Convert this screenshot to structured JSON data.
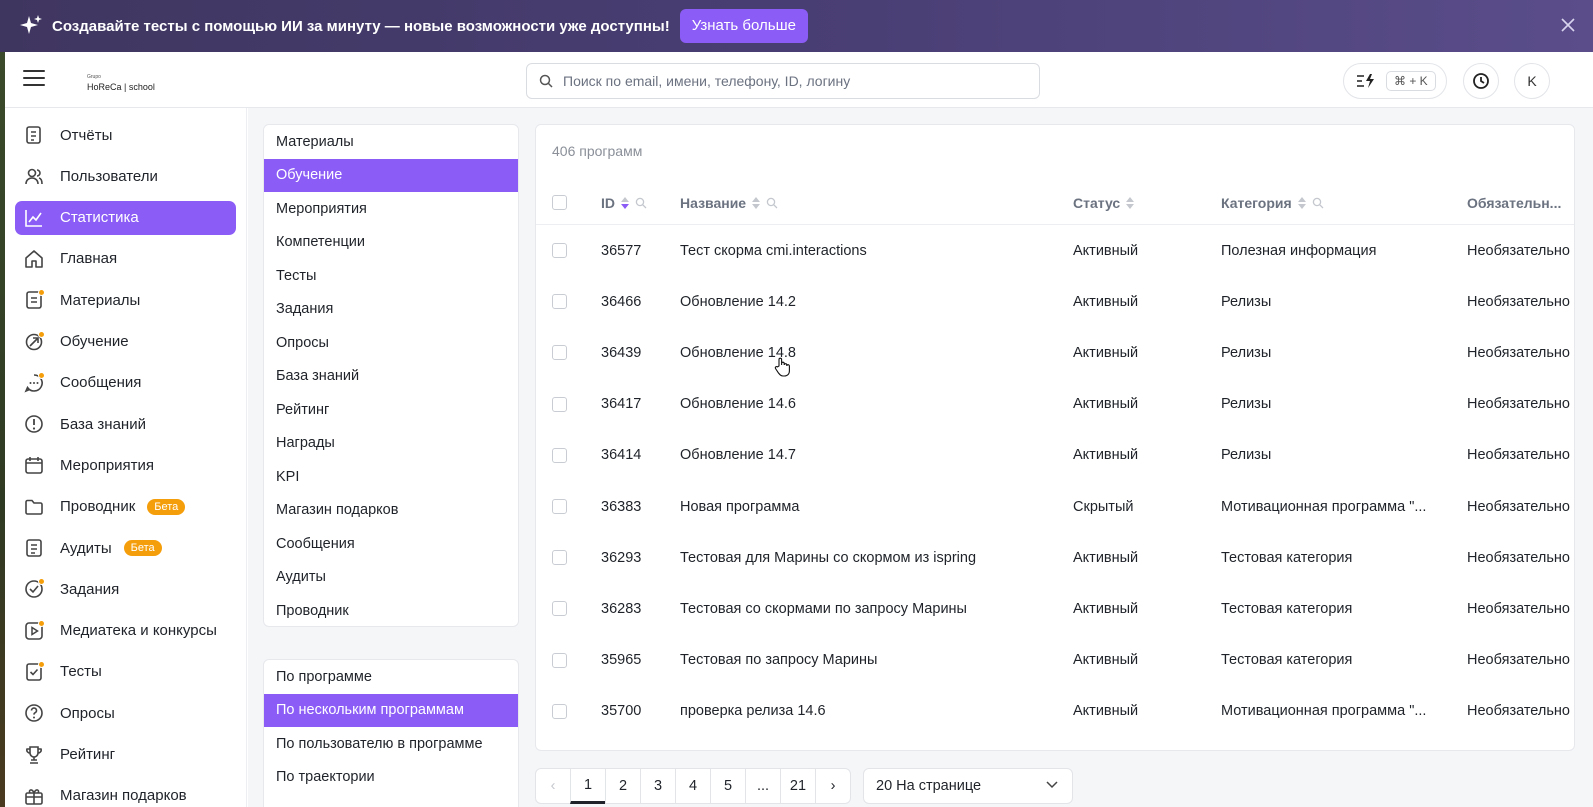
{
  "banner": {
    "text": "Создавайте тесты с помощью ИИ за минуту — новые возможности уже доступны!",
    "button": "Узнать больше"
  },
  "header": {
    "logo_small": "Grupo",
    "logo_text": "HoReCa | school",
    "search_placeholder": "Поиск по email, имени, телефону, ID, логину",
    "shortcut": "⌘ + K",
    "avatar": "K"
  },
  "sidebar": {
    "items": [
      {
        "label": "Отчёты",
        "icon": "report-icon",
        "dot": false
      },
      {
        "label": "Пользователи",
        "icon": "users-icon",
        "dot": false
      },
      {
        "label": "Статистика",
        "icon": "chart-icon",
        "dot": false,
        "active": true
      },
      {
        "label": "Главная",
        "icon": "home-icon",
        "dot": false
      },
      {
        "label": "Материалы",
        "icon": "document-icon",
        "dot": true
      },
      {
        "label": "Обучение",
        "icon": "learning-icon",
        "dot": true
      },
      {
        "label": "Сообщения",
        "icon": "chat-icon",
        "dot": true
      },
      {
        "label": "База знаний",
        "icon": "info-icon",
        "dot": false
      },
      {
        "label": "Мероприятия",
        "icon": "calendar-icon",
        "dot": false
      },
      {
        "label": "Проводник",
        "icon": "folder-icon",
        "dot": false,
        "badge": "Бета"
      },
      {
        "label": "Аудиты",
        "icon": "audit-icon",
        "dot": false,
        "badge": "Бета"
      },
      {
        "label": "Задания",
        "icon": "task-icon",
        "dot": true
      },
      {
        "label": "Медиатека и конкурсы",
        "icon": "media-icon",
        "dot": true
      },
      {
        "label": "Тесты",
        "icon": "test-icon",
        "dot": true
      },
      {
        "label": "Опросы",
        "icon": "question-icon",
        "dot": false
      },
      {
        "label": "Рейтинг",
        "icon": "trophy-icon",
        "dot": false
      },
      {
        "label": "Магазин подарков",
        "icon": "gift-icon",
        "dot": false
      }
    ]
  },
  "categories": [
    "Материалы",
    "Обучение",
    "Мероприятия",
    "Компетенции",
    "Тесты",
    "Задания",
    "Опросы",
    "База знаний",
    "Рейтинг",
    "Награды",
    "KPI",
    "Магазин подарков",
    "Сообщения",
    "Аудиты",
    "Проводник"
  ],
  "categories_active": 1,
  "reports": [
    "По программе",
    "По нескольким программам",
    "По пользователю в программе",
    "По траектории"
  ],
  "reports_active": 1,
  "table": {
    "count": "406 программ",
    "columns": [
      "ID",
      "Название",
      "Статус",
      "Категория",
      "Обязательн..."
    ],
    "rows": [
      [
        "36577",
        "Тест скорма cmi.interactions",
        "Активный",
        "Полезная информация",
        "Необязательно"
      ],
      [
        "36466",
        "Обновление 14.2",
        "Активный",
        "Релизы",
        "Необязательно"
      ],
      [
        "36439",
        "Обновление 14.8",
        "Активный",
        "Релизы",
        "Необязательно"
      ],
      [
        "36417",
        "Обновление 14.6",
        "Активный",
        "Релизы",
        "Необязательно"
      ],
      [
        "36414",
        "Обновление 14.7",
        "Активный",
        "Релизы",
        "Необязательно"
      ],
      [
        "36383",
        "Новая программа",
        "Скрытый",
        "Мотивационная программа \"...",
        "Необязательно"
      ],
      [
        "36293",
        "Тестовая для Марины со скормом из ispring",
        "Активный",
        "Тестовая категория",
        "Необязательно"
      ],
      [
        "36283",
        "Тестовая со скормами по запросу Марины",
        "Активный",
        "Тестовая категория",
        "Необязательно"
      ],
      [
        "35965",
        "Тестовая по запросу Марины",
        "Активный",
        "Тестовая категория",
        "Необязательно"
      ],
      [
        "35700",
        "проверка релиза 14.6",
        "Активный",
        "Мотивационная программа \"...",
        "Необязательно"
      ]
    ]
  },
  "pagination": {
    "prev": "‹",
    "pages": [
      "1",
      "2",
      "3",
      "4",
      "5",
      "...",
      "21"
    ],
    "next": "›",
    "active": "1",
    "per_page": "20 На странице"
  },
  "colors": {
    "accent": "#8b5cf6",
    "badge": "#f59e0b"
  }
}
